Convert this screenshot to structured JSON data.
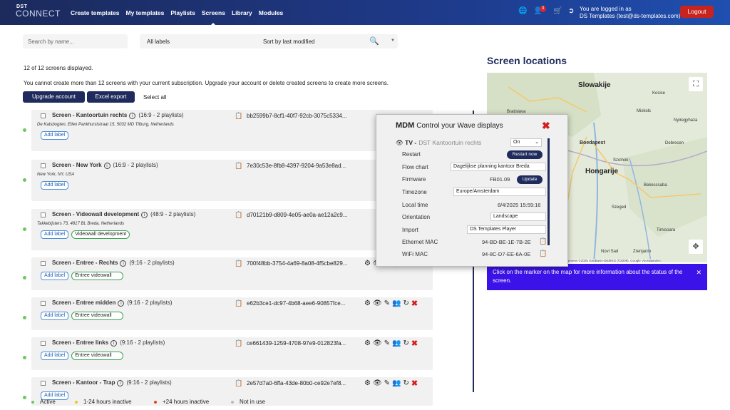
{
  "nav": {
    "logo_top": "DST",
    "logo_bottom": "CONNECT",
    "links": [
      "Create templates",
      "My templates",
      "Playlists",
      "Screens",
      "Library",
      "Modules"
    ],
    "cart_badge": "3",
    "logged_line1": "You are logged in as",
    "logged_line2": "DS Templates (test@ds-templates.com)",
    "logout": "Logout"
  },
  "toolbar": {
    "search_placeholder": "Search by name...",
    "labels_filter": "All labels",
    "sort": "Sort by last modified"
  },
  "summary": {
    "count": "12 of 12 screens displayed.",
    "warning": "You cannot create more than 12 screens with your current subscription. Upgrade your account or delete created screens to create more screens.",
    "upgrade": "Upgrade account",
    "export": "Excel export",
    "select_all": "Select all"
  },
  "screens": [
    {
      "name": "Screen - Kantoortuin rechts",
      "meta": "(16:9 - 2 playlists)",
      "address": "De Katsbogten, Ellen Pankhurststraat 15, 5032 MD Tilburg, Netherlands",
      "uuid": "bb2599b7-8cf1-40f7-92cb-3075c5334...",
      "labels": [],
      "status": "active"
    },
    {
      "name": "Screen - New York",
      "meta": "(16:9 - 2 playlists)",
      "address": "New York, NY, USA",
      "uuid": "7e30c53e-8fb8-4397-9204-9a53e8ad...",
      "labels": [],
      "status": "active"
    },
    {
      "name": "Screen - Videowall development",
      "meta": "(48:9 - 2 playlists)",
      "address": "Takkebijsters 73, 4817 BL Breda, Netherlands",
      "uuid": "d70121b9-d809-4e05-ae0a-ae12a2c9...",
      "labels": [
        "Videowall development"
      ],
      "status": "active"
    },
    {
      "name": "Screen - Entree - Rechts",
      "meta": "(9:16 - 2 playlists)",
      "address": "",
      "uuid": "700f48bb-3754-4a69-8a08-4f5cbe829...",
      "labels": [
        "Entree videowall"
      ],
      "status": "active"
    },
    {
      "name": "Screen - Entree midden",
      "meta": "(9:16 - 2 playlists)",
      "address": "",
      "uuid": "e62b3ce1-dc97-4b68-aee6-90857fce...",
      "labels": [
        "Entree videowall"
      ],
      "status": "active"
    },
    {
      "name": "Screen - Entree links",
      "meta": "(9:16 - 2 playlists)",
      "address": "",
      "uuid": "ce661439-1259-4708-97e9-012823fa...",
      "labels": [
        "Entree videowall"
      ],
      "status": "active"
    },
    {
      "name": "Screen - Kantoor - Trap",
      "meta": "(9:16 - 2 playlists)",
      "address": "",
      "uuid": "2e57d7a0-6ffa-43de-80b0-ce92e7ef8...",
      "labels": [],
      "status": "active"
    }
  ],
  "add_label": "Add label",
  "legend": [
    {
      "label": "Active",
      "color": "#6bc95c"
    },
    {
      "label": "1-24 hours inactive",
      "color": "#e8c81e"
    },
    {
      "label": "+24 hours inactive",
      "color": "#d9472b"
    },
    {
      "label": "Not in use",
      "color": "#bbbbbb"
    }
  ],
  "map": {
    "title": "Screen locations",
    "labels": [
      "Slowakije",
      "Hongarije",
      "Boedapest",
      "Kosice",
      "Miskolc",
      "Debrecen",
      "Szolnok",
      "Szeged",
      "Timisoara",
      "Novi Sad",
      "Zrenjanin",
      "Bratislava",
      "Nyiregyhaza",
      "Bekescsaba"
    ],
    "attribution": "Kaartgegevens ©2025 GeoBasis-DE/BKG (©2009), Google   Voorwaarden",
    "note": "Click on the marker on the map for more information about the status of the screen."
  },
  "mdm": {
    "title_bold": "MDM",
    "title": "Control your Wave displays",
    "device": "TV -",
    "device_name": "DST Kantoortuin rechts",
    "power": "On",
    "rows": [
      {
        "label": "Restart",
        "button": "Restart now"
      },
      {
        "label": "Flow chart",
        "select": "Dagelijkse planning kantoor Breda"
      },
      {
        "label": "Firmware",
        "value": "FB01.09",
        "button": "Update"
      },
      {
        "label": "Timezone",
        "select": "Europe/Amsterdam"
      },
      {
        "label": "Local time",
        "value": "8/4/2025 15:59:16"
      },
      {
        "label": "Orientation",
        "select": "Landscape"
      },
      {
        "label": "Import",
        "select": "DS Templates Player"
      },
      {
        "label": "Ethernet MAC",
        "value": "94-BD-BE-1E-7B-2E"
      },
      {
        "label": "WiFi MAC",
        "value": "94-8C-D7-EE-6A-0E"
      }
    ]
  }
}
